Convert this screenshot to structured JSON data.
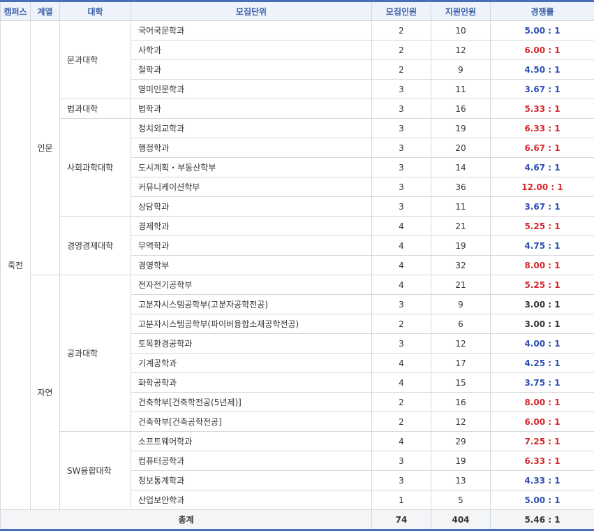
{
  "headers": {
    "campus": "캠퍼스",
    "field": "계열",
    "college": "대학",
    "unit": "모집단위",
    "quota": "모집인원",
    "applicants": "지원인원",
    "ratio": "경쟁률"
  },
  "campus": "죽전",
  "fields": [
    "인문",
    "자연"
  ],
  "colleges": [
    "문과대학",
    "법과대학",
    "사회과학대학",
    "경영경제대학",
    "공과대학",
    "SW융합대학"
  ],
  "rows": [
    {
      "unit": "국어국문학과",
      "quota": "2",
      "applicants": "10",
      "ratio": "5.00 : 1",
      "color": "#2b4fb3"
    },
    {
      "unit": "사학과",
      "quota": "2",
      "applicants": "12",
      "ratio": "6.00 : 1",
      "color": "#d7262b"
    },
    {
      "unit": "철학과",
      "quota": "2",
      "applicants": "9",
      "ratio": "4.50 : 1",
      "color": "#2b4fb3"
    },
    {
      "unit": "영미인문학과",
      "quota": "3",
      "applicants": "11",
      "ratio": "3.67 : 1",
      "color": "#2b4fb3"
    },
    {
      "unit": "법학과",
      "quota": "3",
      "applicants": "16",
      "ratio": "5.33 : 1",
      "color": "#d7262b"
    },
    {
      "unit": "정치외교학과",
      "quota": "3",
      "applicants": "19",
      "ratio": "6.33 : 1",
      "color": "#d7262b"
    },
    {
      "unit": "행정학과",
      "quota": "3",
      "applicants": "20",
      "ratio": "6.67 : 1",
      "color": "#d7262b"
    },
    {
      "unit": "도시계획・부동산학부",
      "quota": "3",
      "applicants": "14",
      "ratio": "4.67 : 1",
      "color": "#2b4fb3"
    },
    {
      "unit": "커뮤니케이션학부",
      "quota": "3",
      "applicants": "36",
      "ratio": "12.00 : 1",
      "color": "#d7262b"
    },
    {
      "unit": "상담학과",
      "quota": "3",
      "applicants": "11",
      "ratio": "3.67 : 1",
      "color": "#2b4fb3"
    },
    {
      "unit": "경제학과",
      "quota": "4",
      "applicants": "21",
      "ratio": "5.25 : 1",
      "color": "#d7262b"
    },
    {
      "unit": "무역학과",
      "quota": "4",
      "applicants": "19",
      "ratio": "4.75 : 1",
      "color": "#2b4fb3"
    },
    {
      "unit": "경영학부",
      "quota": "4",
      "applicants": "32",
      "ratio": "8.00 : 1",
      "color": "#d7262b"
    },
    {
      "unit": "전자전기공학부",
      "quota": "4",
      "applicants": "21",
      "ratio": "5.25 : 1",
      "color": "#d7262b"
    },
    {
      "unit": "고분자시스템공학부(고분자공학전공)",
      "quota": "3",
      "applicants": "9",
      "ratio": "3.00 : 1",
      "color": "#333333"
    },
    {
      "unit": "고분자시스템공학부(파이버융합소재공학전공)",
      "quota": "2",
      "applicants": "6",
      "ratio": "3.00 : 1",
      "color": "#333333"
    },
    {
      "unit": "토목환경공학과",
      "quota": "3",
      "applicants": "12",
      "ratio": "4.00 : 1",
      "color": "#2b4fb3"
    },
    {
      "unit": "기계공학과",
      "quota": "4",
      "applicants": "17",
      "ratio": "4.25 : 1",
      "color": "#2b4fb3"
    },
    {
      "unit": "화학공학과",
      "quota": "4",
      "applicants": "15",
      "ratio": "3.75 : 1",
      "color": "#2b4fb3"
    },
    {
      "unit": "건축학부[건축학전공(5년제)]",
      "quota": "2",
      "applicants": "16",
      "ratio": "8.00 : 1",
      "color": "#d7262b"
    },
    {
      "unit": "건축학부[건축공학전공]",
      "quota": "2",
      "applicants": "12",
      "ratio": "6.00 : 1",
      "color": "#d7262b"
    },
    {
      "unit": "소프트웨어학과",
      "quota": "4",
      "applicants": "29",
      "ratio": "7.25 : 1",
      "color": "#d7262b"
    },
    {
      "unit": "컴퓨터공학과",
      "quota": "3",
      "applicants": "19",
      "ratio": "6.33 : 1",
      "color": "#d7262b"
    },
    {
      "unit": "정보통계학과",
      "quota": "3",
      "applicants": "13",
      "ratio": "4.33 : 1",
      "color": "#2b4fb3"
    },
    {
      "unit": "산업보안학과",
      "quota": "1",
      "applicants": "5",
      "ratio": "5.00 : 1",
      "color": "#2b4fb3"
    }
  ],
  "total": {
    "label": "총계",
    "quota": "74",
    "applicants": "404",
    "ratio": "5.46 : 1"
  }
}
